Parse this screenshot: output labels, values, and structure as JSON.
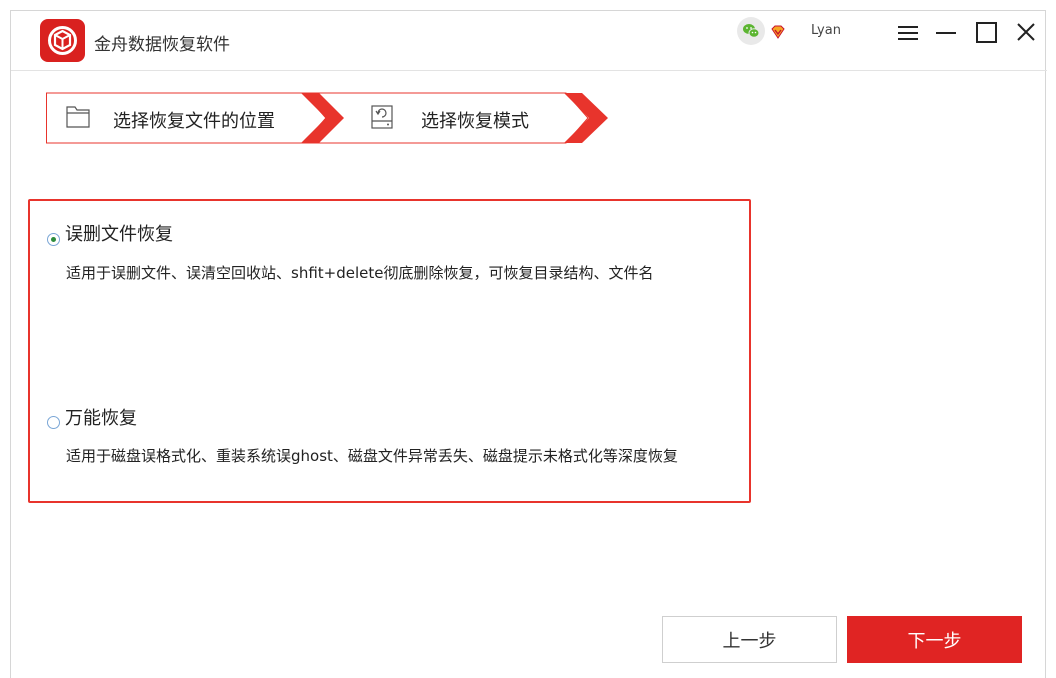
{
  "app": {
    "title": "金舟数据恢复软件",
    "username": "Lyan"
  },
  "colors": {
    "accent": "#e02423",
    "border_red": "#e8342c",
    "radio_dot": "#2d8c3c"
  },
  "icons": {
    "logo": "app-logo-icon",
    "wechat": "wechat-icon",
    "vip": "vip-diamond-icon",
    "menu": "menu-icon",
    "minimize": "minimize-icon",
    "maximize": "maximize-icon",
    "close": "close-icon",
    "folder": "folder-icon",
    "drive": "drive-restore-icon"
  },
  "steps": [
    {
      "label": "选择恢复文件的位置"
    },
    {
      "label": "选择恢复模式"
    }
  ],
  "options": [
    {
      "title": "误删文件恢复",
      "desc": "适用于误删文件、误清空回收站、shfit+delete彻底删除恢复，可恢复目录结构、文件名",
      "selected": true
    },
    {
      "title": "万能恢复",
      "desc": "适用于磁盘误格式化、重装系统误ghost、磁盘文件异常丢失、磁盘提示未格式化等深度恢复",
      "selected": false
    }
  ],
  "buttons": {
    "prev": "上一步",
    "next": "下一步"
  }
}
